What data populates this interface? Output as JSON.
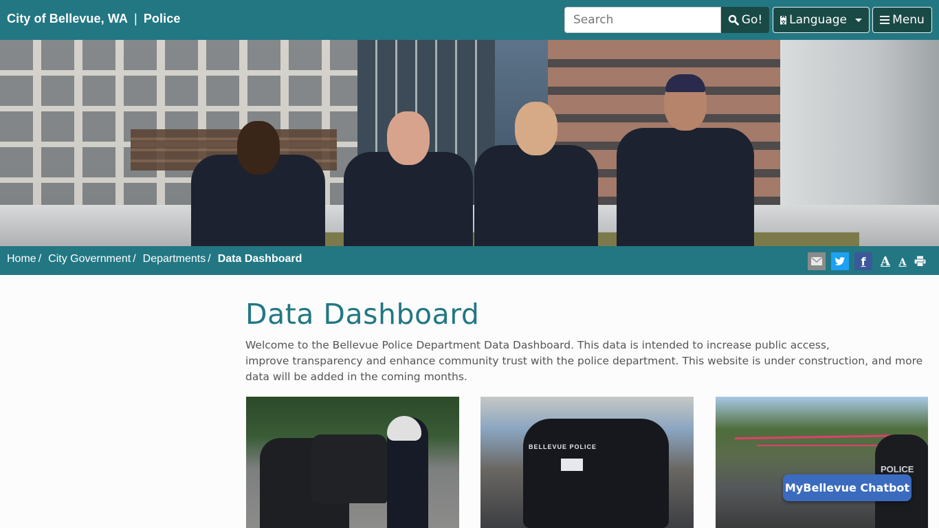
{
  "header": {
    "site_name": "City of Bellevue, WA",
    "separator": "|",
    "section": "Police",
    "search": {
      "placeholder": "Search",
      "value": "",
      "button_label": "Go!",
      "button_icon": "search-icon"
    },
    "language_button": {
      "label": "Language",
      "icon": "translate-icon"
    },
    "menu_button": {
      "label": "Menu",
      "icon": "hamburger-icon"
    }
  },
  "hero": {
    "alt": "Four Bellevue police officers standing on a rooftop in front of downtown buildings"
  },
  "breadcrumb": {
    "items": [
      {
        "label": "Home"
      },
      {
        "label": "City Government"
      },
      {
        "label": "Departments"
      }
    ],
    "separator": "/",
    "current": "Data Dashboard"
  },
  "page_tools": [
    {
      "name": "email-share",
      "icon": "envelope-icon",
      "glyph": "✉"
    },
    {
      "name": "twitter-share",
      "icon": "twitter-icon",
      "glyph": "🐦"
    },
    {
      "name": "facebook-share",
      "icon": "facebook-icon",
      "glyph": "f"
    },
    {
      "name": "increase-font",
      "icon": "font-increase-icon",
      "glyph": "A"
    },
    {
      "name": "decrease-font",
      "icon": "font-decrease-icon",
      "glyph": "A"
    },
    {
      "name": "print",
      "icon": "print-icon",
      "glyph": "🖶"
    }
  ],
  "main": {
    "title": "Data Dashboard",
    "intro_lines": [
      "Welcome to the Bellevue Police Department Data Dashboard.  This data is intended to increase public access,",
      "improve transparency and enhance community trust with the police department. This website is under construction, and more",
      "data will be added in the coming months."
    ],
    "cards": [
      {
        "alt": "Motorcycle officer writing a report next to a car",
        "overlay_text": ""
      },
      {
        "alt": "Rear of a Bellevue Police SUV",
        "overlay_text": "BELLEVUE  POLICE"
      },
      {
        "alt": "Crime scene tape with officer in foreground",
        "overlay_text": "POLICE"
      }
    ]
  },
  "chatbot": {
    "label": "MyBellevue Chatbot"
  },
  "colors": {
    "brand_teal": "#227783",
    "dark_button": "#1a4a46",
    "chatbot_blue": "#3b6bbf",
    "twitter_blue": "#1da1f2",
    "facebook_blue": "#3b5998",
    "email_gray": "#8a8b8b"
  }
}
